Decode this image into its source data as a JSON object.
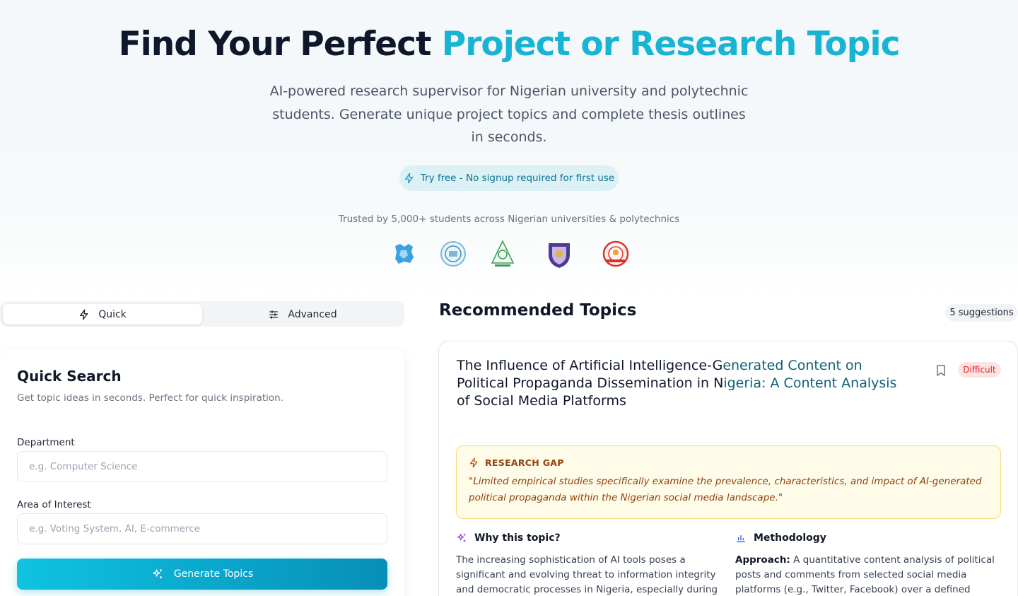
{
  "hero": {
    "title_main": "Find Your Perfect ",
    "title_accent": "Project or Research Topic",
    "subtitle": "AI-powered research supervisor for Nigerian university and polytechnic students. Generate unique project topics and complete thesis outlines in seconds.",
    "pill_text": "Try free - No signup required for first use",
    "trusted_text": "Trusted by 5,000+ students across Nigerian universities & polytechnics"
  },
  "logos": [
    "university-logo-1",
    "university-logo-2",
    "university-logo-3",
    "university-logo-4",
    "university-logo-5"
  ],
  "tabs": [
    {
      "label": "Quick",
      "icon": "lightning-icon",
      "active": true
    },
    {
      "label": "Advanced",
      "icon": "sliders-icon",
      "active": false
    }
  ],
  "quick_search": {
    "title": "Quick Search",
    "subtitle": "Get topic ideas in seconds. Perfect for quick inspiration.",
    "department_label": "Department",
    "department_placeholder": "e.g. Computer Science",
    "department_value": "",
    "interest_label": "Area of Interest",
    "interest_placeholder": "e.g. Voting System, AI, E-commerce",
    "interest_value": "",
    "button_label": "Generate Topics"
  },
  "recommended": {
    "title": "Recommended Topics",
    "count_label": "5 suggestions",
    "topic": {
      "title_part1": "The Influence of Artificial Intelligence-G",
      "title_part2": "enerated Content on",
      "title_part3": "Political Propaganda Dissemination in N",
      "title_part4": "igeria: A Content Analysis",
      "title_part5": "of Social Media Platforms",
      "difficulty": "Difficult",
      "gap_label": "RESEARCH GAP",
      "gap_text": "\"Limited empirical studies specifically examine the prevalence, characteristics, and impact of AI-generated political propaganda within the Nigerian social media landscape.\"",
      "why_label": "Why this topic?",
      "why_text": "The increasing sophistication of AI tools poses a significant and evolving threat to information integrity and democratic processes in Nigeria, especially during critical election",
      "method_label": "Methodology",
      "method_prefix": "Approach:",
      "method_text": " A quantitative content analysis of political posts and comments from selected social media platforms (e.g., Twitter, Facebook) over a defined period, focusing on"
    }
  },
  "colors": {
    "accent": "#17b4d3",
    "accent_dark": "#0b5f73",
    "difficult": "#dc2626",
    "gap": "#92400e"
  }
}
